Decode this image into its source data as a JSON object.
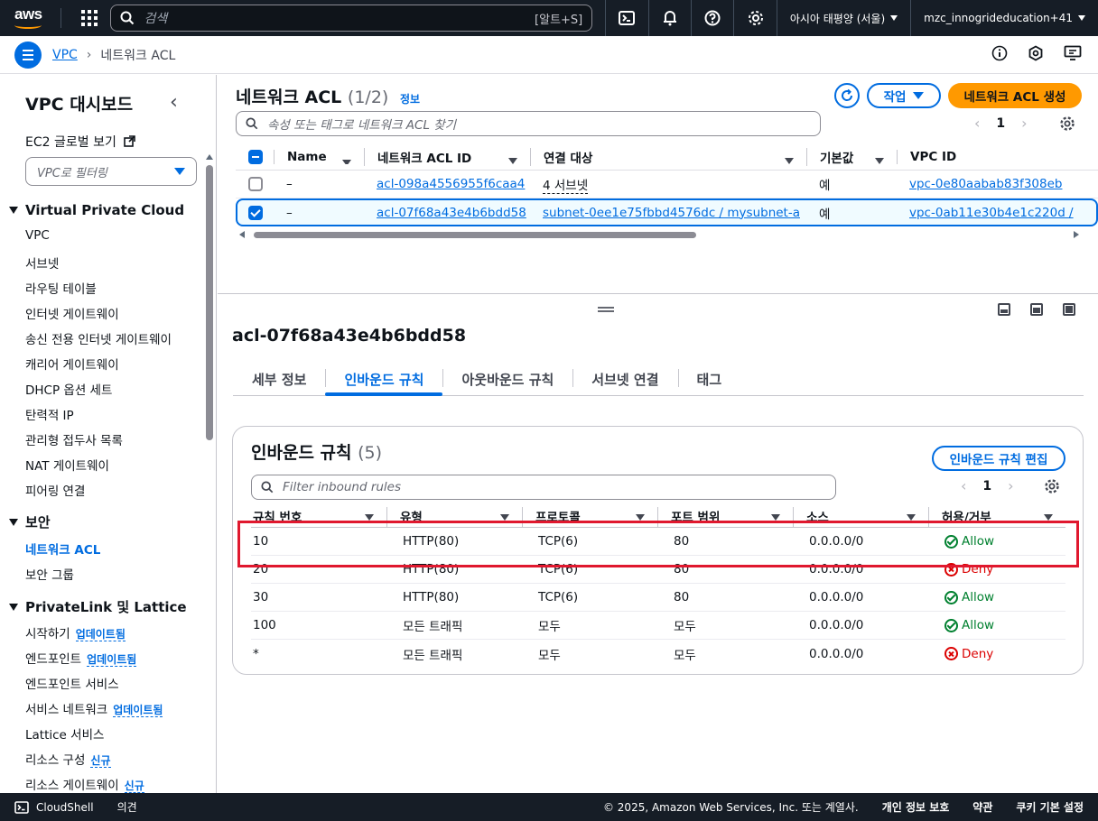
{
  "topnav": {
    "logo": "aws",
    "search_placeholder": "검색",
    "search_shortcut": "[알트+S]",
    "region": "아시아 태평양 (서울)",
    "account": "mzc_innogrideducation+41"
  },
  "breadcrumb": {
    "parent": "VPC",
    "current": "네트워크 ACL"
  },
  "sidebar": {
    "title": "VPC 대시보드",
    "ec2_global": "EC2 글로벌 보기",
    "filter_placeholder": "VPC로 필터링",
    "sections": {
      "vpc": "Virtual Private Cloud",
      "security": "보안",
      "privatelink": "PrivateLink 및 Lattice"
    },
    "vpc_items": [
      "VPC",
      "서브넷",
      "라우팅 테이블",
      "인터넷 게이트웨이",
      "송신 전용 인터넷 게이트웨이",
      "캐리어 게이트웨이",
      "DHCP 옵션 세트",
      "탄력적 IP",
      "관리형 접두사 목록",
      "NAT 게이트웨이",
      "피어링 연결"
    ],
    "security_items": [
      "네트워크 ACL",
      "보안 그룹"
    ],
    "privatelink_items": [
      {
        "label": "시작하기",
        "badge": "업데이트됨"
      },
      {
        "label": "엔드포인트",
        "badge": "업데이트됨"
      },
      {
        "label": "엔드포인트 서비스",
        "badge": ""
      },
      {
        "label": "서비스 네트워크",
        "badge": "업데이트됨"
      },
      {
        "label": "Lattice 서비스",
        "badge": ""
      },
      {
        "label": "리소스 구성",
        "badge": "신규"
      },
      {
        "label": "리소스 게이트웨이",
        "badge": "신규"
      }
    ]
  },
  "acl_list": {
    "title": "네트워크 ACL",
    "count": "(1/2)",
    "info": "정보",
    "action_label": "작업",
    "create_label": "네트워크 ACL 생성",
    "search_placeholder": "속성 또는 태그로 네트워크 ACL 찾기",
    "page": "1",
    "columns": [
      "Name",
      "네트워크 ACL ID",
      "연결 대상",
      "기본값",
      "VPC ID"
    ],
    "rows": [
      {
        "name": "–",
        "id": "acl-098a4556955f6caa4",
        "assoc": "4 서브넷",
        "default": "예",
        "vpc": "vpc-0e80aabab83f308eb",
        "selected": false
      },
      {
        "name": "–",
        "id": "acl-07f68a43e4b6bdd58",
        "assoc": "subnet-0ee1e75fbbd4576dc / mysubnet-a",
        "default": "예",
        "vpc": "vpc-0ab11e30b4e1c220d /",
        "selected": true
      }
    ]
  },
  "detail": {
    "title": "acl-07f68a43e4b6bdd58",
    "tabs": [
      "세부 정보",
      "인바운드 규칙",
      "아웃바운드 규칙",
      "서브넷 연결",
      "태그"
    ],
    "active_tab": 1
  },
  "inbound": {
    "title": "인바운드 규칙",
    "count": "(5)",
    "edit_label": "인바운드 규칙 편집",
    "search_placeholder": "Filter inbound rules",
    "page": "1",
    "columns": [
      "규칙 번호",
      "유형",
      "프로토콜",
      "포트 범위",
      "소스",
      "허용/거부"
    ],
    "rows": [
      {
        "num": "10",
        "type": "HTTP(80)",
        "proto": "TCP(6)",
        "port": "80",
        "src": "0.0.0.0/0",
        "action": "Allow"
      },
      {
        "num": "20",
        "type": "HTTP(80)",
        "proto": "TCP(6)",
        "port": "80",
        "src": "0.0.0.0/0",
        "action": "Deny"
      },
      {
        "num": "30",
        "type": "HTTP(80)",
        "proto": "TCP(6)",
        "port": "80",
        "src": "0.0.0.0/0",
        "action": "Allow"
      },
      {
        "num": "100",
        "type": "모든 트래픽",
        "proto": "모두",
        "port": "모두",
        "src": "0.0.0.0/0",
        "action": "Allow"
      },
      {
        "num": "*",
        "type": "모든 트래픽",
        "proto": "모두",
        "port": "모두",
        "src": "0.0.0.0/0",
        "action": "Deny"
      }
    ]
  },
  "footer": {
    "cloudshell": "CloudShell",
    "feedback": "의견",
    "copyright": "© 2025, Amazon Web Services, Inc. 또는 계열사.",
    "privacy": "개인 정보 보호",
    "terms": "약관",
    "cookies": "쿠키 기본 설정"
  },
  "colors": {
    "nav_bg": "#161d26",
    "link": "#006ce0",
    "primary_button": "#ff9900",
    "allow": "#00802f",
    "deny": "#db0000",
    "highlight": "#e0182e"
  }
}
